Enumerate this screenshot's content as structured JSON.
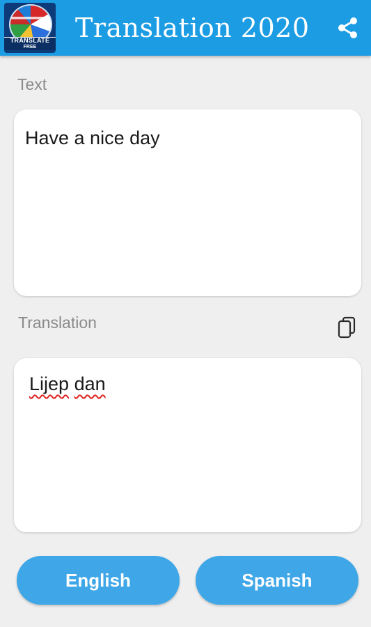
{
  "appbar": {
    "title": "Translation 2020",
    "logo_text_top": "TRANSLATE",
    "logo_text_bottom": "FREE",
    "share_icon": "share-icon",
    "color": "#1b9ce3"
  },
  "source": {
    "label": "Text",
    "value": "Have a nice day"
  },
  "target": {
    "label": "Translation",
    "words": [
      "Lijep",
      "dan"
    ],
    "copy_icon": "copy-icon"
  },
  "languages": {
    "from": "English",
    "to": "Spanish",
    "button_color": "#3fa7e8"
  }
}
